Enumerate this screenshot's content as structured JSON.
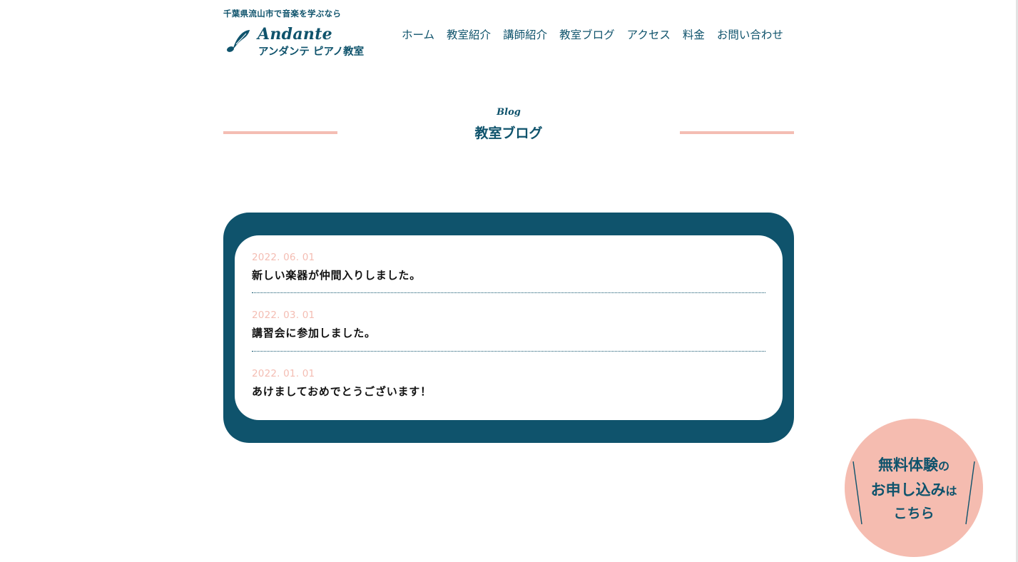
{
  "header": {
    "tagline": "千葉県流山市で音楽を学ぶなら",
    "logo_en": "Andante",
    "logo_ja": "アンダンテ ピアノ教室",
    "logo_icon": "quill-note-icon"
  },
  "nav": {
    "items": [
      {
        "label": "ホーム"
      },
      {
        "label": "教室紹介"
      },
      {
        "label": "講師紹介"
      },
      {
        "label": "教室ブログ"
      },
      {
        "label": "アクセス"
      },
      {
        "label": "料金"
      },
      {
        "label": "お問い合わせ"
      }
    ]
  },
  "section": {
    "title_en": "Blog",
    "title_ja": "教室ブログ"
  },
  "posts": [
    {
      "date": "2022. 06. 01",
      "title": "新しい楽器が仲間入りしました。"
    },
    {
      "date": "2022. 03. 01",
      "title": "講習会に参加しました。"
    },
    {
      "date": "2022. 01. 01",
      "title": "あけましておめでとうございます！"
    }
  ],
  "cta": {
    "line1_main": "無料体験",
    "line1_small": "の",
    "line2_main": "お申し込み",
    "line2_small": "は",
    "line3": "こちら"
  },
  "colors": {
    "primary": "#0f536c",
    "accent_pink": "#f4bdb3",
    "background": "#ffffff",
    "text_dark": "#111111"
  }
}
